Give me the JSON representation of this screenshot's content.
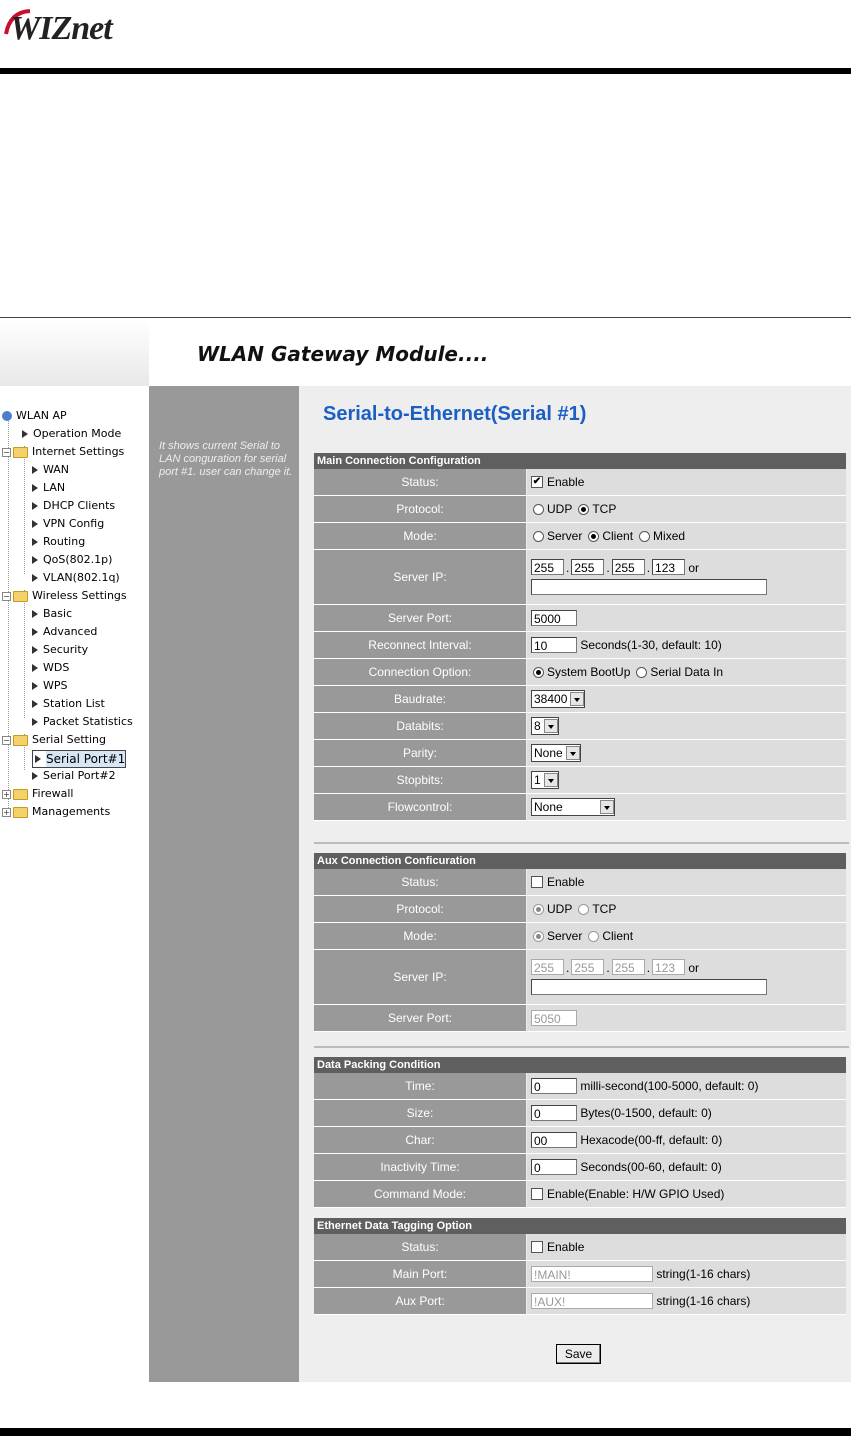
{
  "logo": {
    "text": "WIZnet"
  },
  "header": {
    "title": "WLAN Gateway Module...."
  },
  "nav": {
    "root": "WLAN AP",
    "operation_mode": "Operation Mode",
    "internet_settings": "Internet Settings",
    "internet_items": [
      "WAN",
      "LAN",
      "DHCP Clients",
      "VPN Config",
      "Routing",
      "QoS(802.1p)",
      "VLAN(802.1q)"
    ],
    "wireless_settings": "Wireless Settings",
    "wireless_items": [
      "Basic",
      "Advanced",
      "Security",
      "WDS",
      "WPS",
      "Station List",
      "Packet Statistics"
    ],
    "serial_setting": "Serial Setting",
    "serial_items": [
      "Serial Port#1",
      "Serial Port#2"
    ],
    "firewall": "Firewall",
    "managements": "Managements"
  },
  "sidebar": {
    "help": "It shows current Serial to LAN conguration for serial port #1. user can change it."
  },
  "page": {
    "title": "Serial-to-Ethernet(Serial #1)"
  },
  "main": {
    "heading": "Main Connection Configuration",
    "status_label": "Status:",
    "status_checked": true,
    "status_text": "Enable",
    "protocol_label": "Protocol:",
    "protocol_options": [
      "UDP",
      "TCP"
    ],
    "protocol_selected": "TCP",
    "mode_label": "Mode:",
    "mode_options": [
      "Server",
      "Client",
      "Mixed"
    ],
    "mode_selected": "Client",
    "server_ip_label": "Server IP:",
    "server_ip": [
      "255",
      "255",
      "255",
      "123"
    ],
    "or_text": "or",
    "server_host": "",
    "server_port_label": "Server Port:",
    "server_port": "5000",
    "reconnect_label": "Reconnect Interval:",
    "reconnect_value": "10",
    "reconnect_hint": "Seconds(1-30, default: 10)",
    "conn_option_label": "Connection Option:",
    "conn_options": [
      "System BootUp",
      "Serial Data In"
    ],
    "conn_selected": "System BootUp",
    "baudrate_label": "Baudrate:",
    "baudrate": "38400",
    "databits_label": "Databits:",
    "databits": "8",
    "parity_label": "Parity:",
    "parity": "None",
    "stopbits_label": "Stopbits:",
    "stopbits": "1",
    "flow_label": "Flowcontrol:",
    "flow": "None"
  },
  "aux": {
    "heading": "Aux Connection Conficuration",
    "status_label": "Status:",
    "status_checked": false,
    "status_text": "Enable",
    "protocol_label": "Protocol:",
    "protocol_options": [
      "UDP",
      "TCP"
    ],
    "protocol_selected": "UDP",
    "mode_label": "Mode:",
    "mode_options": [
      "Server",
      "Client"
    ],
    "mode_selected": "Server",
    "server_ip_label": "Server IP:",
    "server_ip": [
      "255",
      "255",
      "255",
      "123"
    ],
    "or_text": "or",
    "server_host": "",
    "server_port_label": "Server Port:",
    "server_port": "5050"
  },
  "packing": {
    "heading": "Data Packing Condition",
    "time_label": "Time:",
    "time_value": "0",
    "time_hint": "milli-second(100-5000, default: 0)",
    "size_label": "Size:",
    "size_value": "0",
    "size_hint": "Bytes(0-1500, default: 0)",
    "char_label": "Char:",
    "char_value": "00",
    "char_hint": "Hexacode(00-ff, default: 0)",
    "inactivity_label": "Inactivity Time:",
    "inactivity_value": "0",
    "inactivity_hint": "Seconds(00-60, default: 0)",
    "command_label": "Command Mode:",
    "command_checked": false,
    "command_text": "Enable(Enable: H/W GPIO Used)"
  },
  "tagging": {
    "heading": "Ethernet Data Tagging Option",
    "status_label": "Status:",
    "status_checked": false,
    "status_text": "Enable",
    "main_port_label": "Main Port:",
    "main_port_value": "!MAIN!",
    "main_port_hint": "string(1-16 chars)",
    "aux_port_label": "Aux Port:",
    "aux_port_value": "!AUX!",
    "aux_port_hint": "string(1-16 chars)"
  },
  "actions": {
    "save_label": "Save"
  }
}
